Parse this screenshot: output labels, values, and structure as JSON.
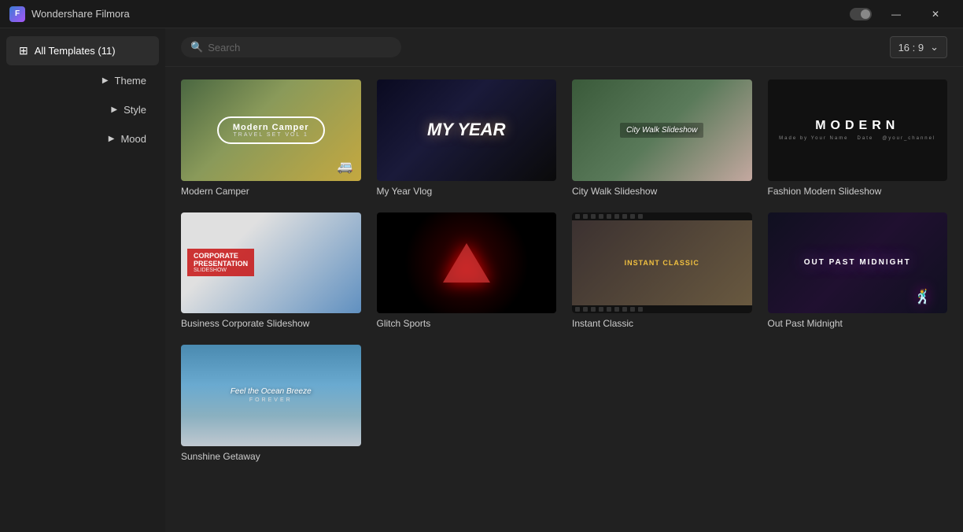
{
  "app": {
    "title": "Wondershare Filmora",
    "controls": {
      "minimize": "—",
      "close": "✕"
    }
  },
  "sidebar": {
    "items": [
      {
        "id": "all-templates",
        "label": "All Templates (11)",
        "icon": "⊞",
        "active": true
      },
      {
        "id": "theme",
        "label": "Theme",
        "arrow": "▶"
      },
      {
        "id": "style",
        "label": "Style",
        "arrow": "▶"
      },
      {
        "id": "mood",
        "label": "Mood",
        "arrow": "▶"
      }
    ]
  },
  "toolbar": {
    "search_placeholder": "Search",
    "aspect_ratio": "16 : 9",
    "chevron": "⌄"
  },
  "templates": [
    {
      "id": "modern-camper",
      "name": "Modern Camper",
      "thumb_type": "modern-camper",
      "mc_title": "Modern Camper",
      "mc_sub": "TRAVEL SET VOL 1"
    },
    {
      "id": "my-year-vlog",
      "name": "My Year Vlog",
      "thumb_type": "my-year",
      "my_text": "MY YEAR"
    },
    {
      "id": "city-walk-slideshow",
      "name": "City Walk Slideshow",
      "thumb_type": "city-walk",
      "cw_text": "City Walk Slideshow"
    },
    {
      "id": "fashion-modern-slideshow",
      "name": "Fashion Modern Slideshow",
      "thumb_type": "fashion",
      "f_modern": "MODERN",
      "f_sub": "Made by Your Name  Date  @your_channel"
    },
    {
      "id": "business-corporate",
      "name": "Business Corporate Slideshow",
      "thumb_type": "business",
      "b_title": "CORPORATE",
      "b_pres": "PRESENTATION",
      "b_sub": "SLIDESHOW"
    },
    {
      "id": "glitch-sports",
      "name": "Glitch Sports",
      "thumb_type": "glitch"
    },
    {
      "id": "instant-classic",
      "name": "Instant Classic",
      "thumb_type": "instant",
      "ic_text": "INSTANT CLASSIC"
    },
    {
      "id": "out-past-midnight",
      "name": "Out Past Midnight",
      "thumb_type": "outpast",
      "op_text": "OUT PAST MIDNIGHT"
    },
    {
      "id": "sunshine-getaway",
      "name": "Sunshine Getaway",
      "thumb_type": "sunshine",
      "s_text": "Feel the Ocean Breeze",
      "s_sub": "FOREVER"
    }
  ]
}
